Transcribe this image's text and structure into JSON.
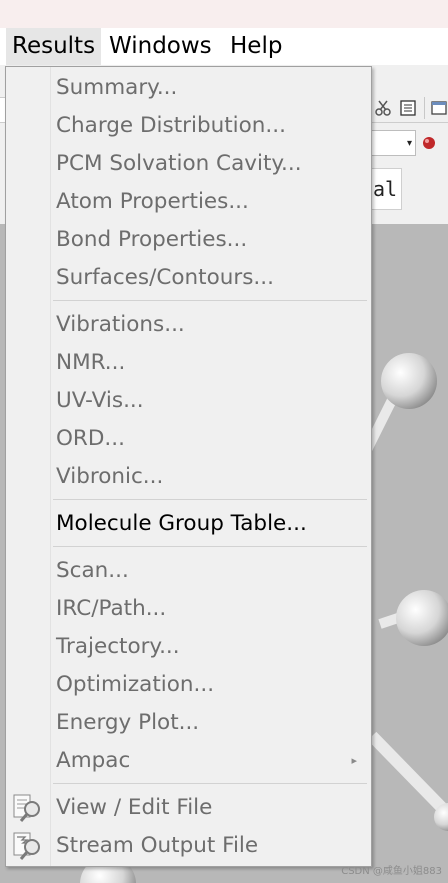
{
  "menubar": {
    "items": [
      {
        "label": "Results",
        "active": true
      },
      {
        "label": "Windows"
      },
      {
        "label": "Help"
      }
    ]
  },
  "background": {
    "text_field_value": "al",
    "combo_arrow": "▾"
  },
  "menu": {
    "items": [
      {
        "label": "Summary...",
        "enabled": false
      },
      {
        "label": "Charge Distribution...",
        "enabled": false
      },
      {
        "label": "PCM Solvation Cavity...",
        "enabled": false
      },
      {
        "label": "Atom Properties...",
        "enabled": false
      },
      {
        "label": "Bond Properties...",
        "enabled": false
      },
      {
        "label": "Surfaces/Contours...",
        "enabled": false
      },
      {
        "label": "Vibrations...",
        "enabled": false
      },
      {
        "label": "NMR...",
        "enabled": false
      },
      {
        "label": "UV-Vis...",
        "enabled": false
      },
      {
        "label": "ORD...",
        "enabled": false
      },
      {
        "label": "Vibronic...",
        "enabled": false
      },
      {
        "label": "Molecule Group Table...",
        "enabled": true
      },
      {
        "label": "Scan...",
        "enabled": false
      },
      {
        "label": "IRC/Path...",
        "enabled": false
      },
      {
        "label": "Trajectory...",
        "enabled": false
      },
      {
        "label": "Optimization...",
        "enabled": false
      },
      {
        "label": "Energy Plot...",
        "enabled": false
      },
      {
        "label": "Ampac",
        "enabled": false,
        "submenu": true,
        "submenu_arrow": "▸"
      },
      {
        "label": "View / Edit File",
        "enabled": false,
        "icon": "file-magnifier-icon"
      },
      {
        "label": "Stream Output File",
        "enabled": false,
        "icon": "stream-file-magnifier-icon"
      }
    ]
  },
  "watermark": "CSDN @咸鱼小姐883"
}
